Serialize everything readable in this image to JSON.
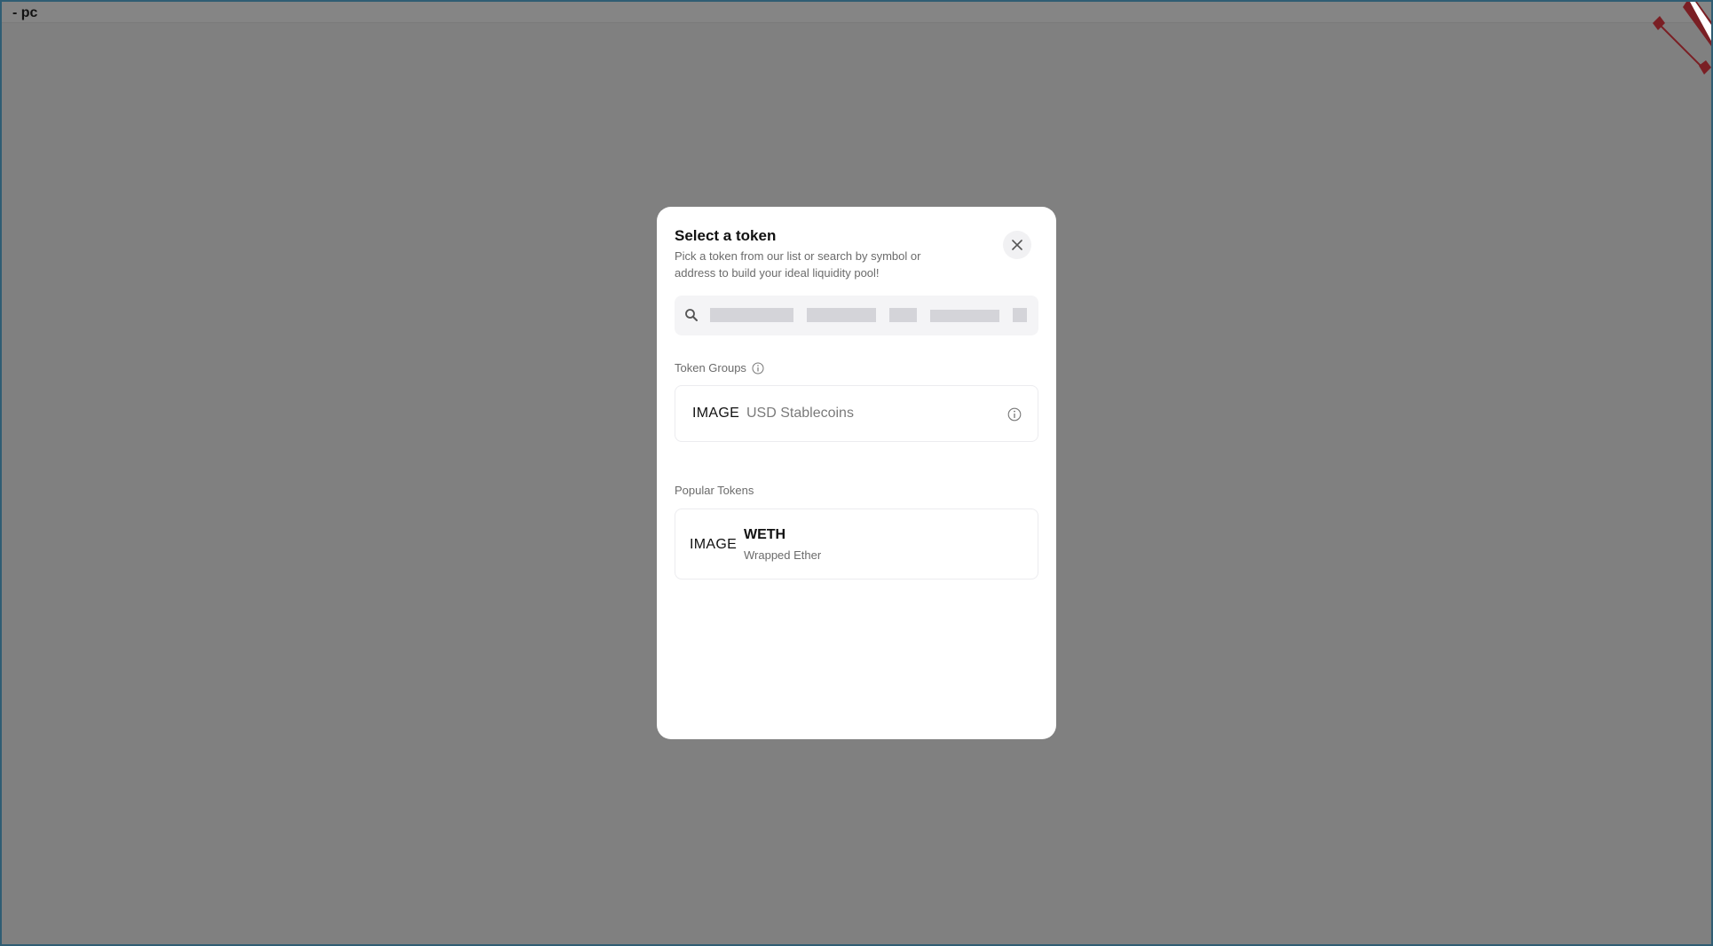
{
  "frame": {
    "label": "- pc"
  },
  "modal": {
    "title": "Select a token",
    "subtitle": "Pick a token from our list or search by symbol or address to build your ideal liquidity pool!",
    "close_icon": "close-icon"
  },
  "search": {
    "placeholder": "",
    "value": "",
    "icon": "search-icon"
  },
  "token_groups": {
    "label": "Token Groups",
    "items": [
      {
        "image": "IMAGE",
        "name": "USD Stablecoins",
        "icon": "info-icon"
      }
    ]
  },
  "popular_tokens": {
    "label": "Popular Tokens",
    "items": [
      {
        "image": "IMAGE",
        "symbol": "WETH",
        "name": "Wrapped Ether"
      }
    ]
  },
  "colors": {
    "overlay": "#808080",
    "frame_border": "#2f5d73",
    "modal_bg": "#ffffff",
    "accent_dark_red": "#7a1f24"
  }
}
